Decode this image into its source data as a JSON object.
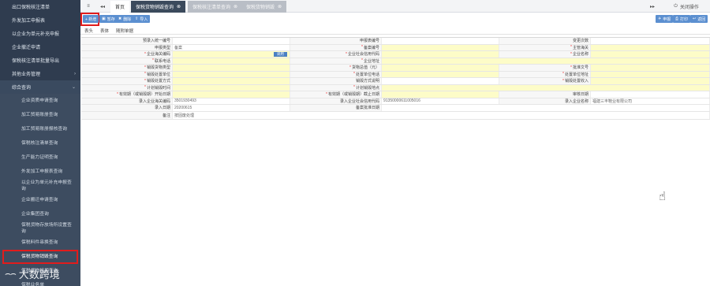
{
  "sidebar": {
    "items": [
      {
        "label": "出口保税核注清单",
        "chevron": ""
      },
      {
        "label": "外发加工申报表",
        "chevron": ""
      },
      {
        "label": "以企业为单元补充申报",
        "chevron": ""
      },
      {
        "label": "企业撤迁申请",
        "chevron": ""
      },
      {
        "label": "保税核注清单批量导出",
        "chevron": ""
      },
      {
        "label": "其他业务管理",
        "chevron": "›"
      },
      {
        "label": "综合查询",
        "chevron": "⌄"
      }
    ],
    "sub_items": [
      {
        "label": "企业资质申请查询"
      },
      {
        "label": "加工贸易账册查询"
      },
      {
        "label": "加工贸易账册报核查询"
      },
      {
        "label": "保税核注清单查询"
      },
      {
        "label": "生产能力证明查询"
      },
      {
        "label": "外发加工申报表查询"
      },
      {
        "label": "以企业为单元补充申报查询"
      },
      {
        "label": "企业搬迁申请查询"
      },
      {
        "label": "企业集团查询"
      },
      {
        "label": "保税货物存放场所设置查询"
      },
      {
        "label": "保税料件串换查询"
      },
      {
        "label": "保税货物销毁查询"
      },
      {
        "label": "保税货物抵押查询"
      }
    ],
    "bottom_item": "保税业务单",
    "watermark": "大数跨境",
    "watermark_logo": "⌢⌢"
  },
  "topbar": {
    "home_icon": "≡",
    "prev_icon": "◂◂",
    "first_tab": "首页",
    "tabs": [
      {
        "label": "保税货物销毁查询",
        "close": "⊗"
      },
      {
        "label": "保税核注清单查询",
        "close": "⊗"
      },
      {
        "label": "保税货物销毁",
        "close": "⊗"
      }
    ],
    "next_icon": "▸▸",
    "close_ops": "关闭操作",
    "close_ops_icon": "⏻"
  },
  "toolbar": {
    "new": "+ 新增",
    "save": "暂存",
    "delete": "删除",
    "import": "导入",
    "declare": "申报",
    "print": "打印",
    "back": "返回",
    "save_icon": "▣",
    "delete_icon": "✖",
    "import_icon": "⇪",
    "declare_icon": "✈",
    "print_icon": "⎙",
    "back_icon": "↩"
  },
  "subtabs": [
    "表头",
    "表体",
    "随附单据"
  ],
  "form": {
    "r1": {
      "l1": "预录入统一编号",
      "v1": "",
      "l2": "申报表编号",
      "v2": "",
      "l3": "变更次数",
      "v3": ""
    },
    "r2": {
      "l1": "申报类型",
      "v1": "备案",
      "l2": "备案编号",
      "v2": "",
      "l3": "主管海关",
      "v3": ""
    },
    "r3": {
      "l1": "企业海关编码",
      "v1": "",
      "btn": "调用",
      "l2": "企业社会信用代码",
      "v2": "",
      "l3": "企业名称",
      "v3": ""
    },
    "r4": {
      "l1": "联系电话",
      "v1": "",
      "l2": "企业地址",
      "v2": ""
    },
    "r5": {
      "l1": "销毁货物类型",
      "v1": "",
      "l2": "货物总值（元）",
      "v2": "",
      "l3": "批准文号",
      "v3": ""
    },
    "r6": {
      "l1": "销毁处置单位",
      "v1": "",
      "l2": "处置单位电话",
      "v2": "",
      "l3": "处置单位地址",
      "v3": ""
    },
    "r7": {
      "l1": "销毁处置方式",
      "v1": "",
      "l2": "销毁方式说明",
      "v2": "",
      "l3": "销毁处置收入",
      "v3": ""
    },
    "r8": {
      "l1": "计划销毁时间",
      "v1": "",
      "l2": "计划销毁地点",
      "v2": ""
    },
    "r9": {
      "l1": "有效期（或销毁期）开始日期",
      "v1": "",
      "l2": "有效期（或销毁期）截止日期",
      "v2": "",
      "l3": "审核日期",
      "v3": ""
    },
    "r10": {
      "l1": "录入企业海关编码",
      "v1": "3501930493",
      "l2": "录入企业社会信用代码",
      "v2": "91350000611005016",
      "l3": "录入企业名称",
      "v3": "福建三丰鞋业有限公司"
    },
    "r11": {
      "l1": "录入日期",
      "v1": "20200615",
      "l2": "备案批准日期",
      "v2": ""
    },
    "r12": {
      "l1": "备注",
      "v1": "按固废处理"
    }
  },
  "cursor_icon": "☝"
}
